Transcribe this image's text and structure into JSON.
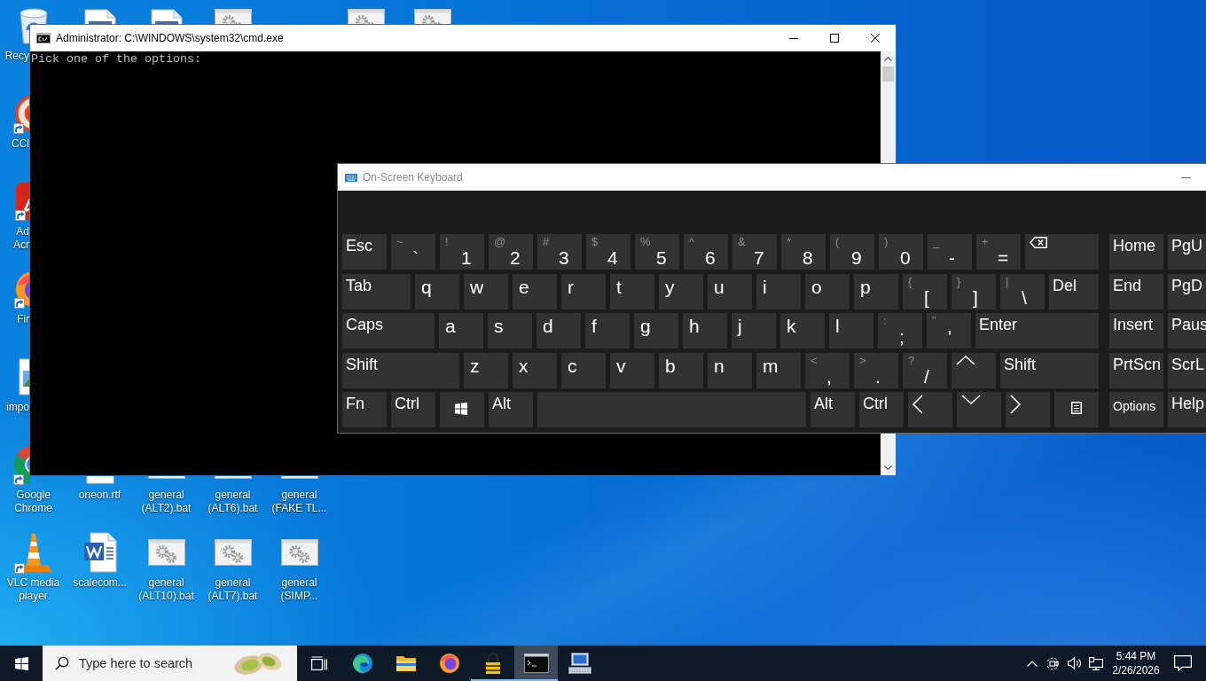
{
  "desktop": {
    "left_edge_icons": [
      {
        "kind": "bin",
        "label": "Recy",
        "shortcut": false
      },
      {
        "kind": "ccleaner",
        "label": "CCl",
        "shortcut": true
      },
      {
        "kind": "acrobat",
        "label": "Ad Acr",
        "shortcut": true
      },
      {
        "kind": "firefox",
        "label": "Fir",
        "shortcut": true
      },
      {
        "kind": "image",
        "label": "impo",
        "shortcut": false
      }
    ],
    "top_edge_icons": [
      {
        "kind": "document"
      },
      {
        "kind": "document"
      },
      {
        "kind": "batch"
      },
      {
        "kind": "batch"
      },
      {
        "kind": "batch"
      }
    ],
    "icon_rows": [
      [
        {
          "kind": "chrome",
          "label": "Google Chrome",
          "shortcut": true
        },
        {
          "kind": "rtf",
          "label": "oneon.rtf",
          "shortcut": false
        },
        {
          "kind": "batch",
          "label": "general (ALT2).bat",
          "shortcut": false
        },
        {
          "kind": "batch",
          "label": "general (ALT6).bat",
          "shortcut": false
        },
        {
          "kind": "batch",
          "label": "general (FAKE TL...",
          "shortcut": false
        }
      ],
      [
        {
          "kind": "vlc",
          "label": "VLC media player",
          "shortcut": true
        },
        {
          "kind": "word",
          "label": "scalecom...",
          "shortcut": false
        },
        {
          "kind": "batch",
          "label": "general (ALT10).bat",
          "shortcut": false
        },
        {
          "kind": "batch",
          "label": "general (ALT7).bat",
          "shortcut": false
        },
        {
          "kind": "batch",
          "label": "general (SIMP...",
          "shortcut": false
        }
      ]
    ]
  },
  "cmd_window": {
    "title": "Administrator: C:\\WINDOWS\\system32\\cmd.exe",
    "lines": [
      "Pick one of the options:"
    ]
  },
  "osk_window": {
    "title": "On-Screen Keyboard",
    "rows": [
      [
        {
          "kind": "word",
          "label": "Esc"
        },
        {
          "kind": "dual",
          "shift": "~",
          "label": "`"
        },
        {
          "kind": "dual",
          "shift": "!",
          "label": "1"
        },
        {
          "kind": "dual",
          "shift": "@",
          "label": "2"
        },
        {
          "kind": "dual",
          "shift": "#",
          "label": "3"
        },
        {
          "kind": "dual",
          "shift": "$",
          "label": "4"
        },
        {
          "kind": "dual",
          "shift": "%",
          "label": "5"
        },
        {
          "kind": "dual",
          "shift": "^",
          "label": "6"
        },
        {
          "kind": "dual",
          "shift": "&",
          "label": "7"
        },
        {
          "kind": "dual",
          "shift": "*",
          "label": "8"
        },
        {
          "kind": "dual",
          "shift": "(",
          "label": "9"
        },
        {
          "kind": "dual",
          "shift": ")",
          "label": "0"
        },
        {
          "kind": "dual",
          "shift": "_",
          "label": "-"
        },
        {
          "kind": "dual",
          "shift": "+",
          "label": "="
        },
        {
          "kind": "backspace"
        }
      ],
      [
        {
          "kind": "word",
          "label": "Tab"
        },
        {
          "kind": "letter",
          "label": "q"
        },
        {
          "kind": "letter",
          "label": "w"
        },
        {
          "kind": "letter",
          "label": "e"
        },
        {
          "kind": "letter",
          "label": "r"
        },
        {
          "kind": "letter",
          "label": "t"
        },
        {
          "kind": "letter",
          "label": "y"
        },
        {
          "kind": "letter",
          "label": "u"
        },
        {
          "kind": "letter",
          "label": "i"
        },
        {
          "kind": "letter",
          "label": "o"
        },
        {
          "kind": "letter",
          "label": "p"
        },
        {
          "kind": "dual",
          "shift": "{",
          "label": "["
        },
        {
          "kind": "dual",
          "shift": "}",
          "label": "]"
        },
        {
          "kind": "dual",
          "shift": "|",
          "label": "\\"
        },
        {
          "kind": "word",
          "label": "Del"
        }
      ],
      [
        {
          "kind": "word",
          "label": "Caps"
        },
        {
          "kind": "letter",
          "label": "a"
        },
        {
          "kind": "letter",
          "label": "s"
        },
        {
          "kind": "letter",
          "label": "d"
        },
        {
          "kind": "letter",
          "label": "f"
        },
        {
          "kind": "letter",
          "label": "g"
        },
        {
          "kind": "letter",
          "label": "h"
        },
        {
          "kind": "letter",
          "label": "j"
        },
        {
          "kind": "letter",
          "label": "k"
        },
        {
          "kind": "letter",
          "label": "l"
        },
        {
          "kind": "dual",
          "shift": ":",
          "label": ";"
        },
        {
          "kind": "dual",
          "shift": "\"",
          "label": "'"
        },
        {
          "kind": "word",
          "label": "Enter"
        }
      ],
      [
        {
          "kind": "word",
          "label": "Shift"
        },
        {
          "kind": "letter",
          "label": "z"
        },
        {
          "kind": "letter",
          "label": "x"
        },
        {
          "kind": "letter",
          "label": "c"
        },
        {
          "kind": "letter",
          "label": "v"
        },
        {
          "kind": "letter",
          "label": "b"
        },
        {
          "kind": "letter",
          "label": "n"
        },
        {
          "kind": "letter",
          "label": "m"
        },
        {
          "kind": "dual",
          "shift": "<",
          "label": ","
        },
        {
          "kind": "dual",
          "shift": ">",
          "label": "."
        },
        {
          "kind": "dual",
          "shift": "?",
          "label": "/"
        },
        {
          "kind": "up"
        },
        {
          "kind": "word",
          "label": "Shift"
        }
      ],
      [
        {
          "kind": "word",
          "label": "Fn"
        },
        {
          "kind": "word",
          "label": "Ctrl"
        },
        {
          "kind": "windows"
        },
        {
          "kind": "word",
          "label": "Alt"
        },
        {
          "kind": "space"
        },
        {
          "kind": "word",
          "label": "Alt"
        },
        {
          "kind": "word",
          "label": "Ctrl"
        },
        {
          "kind": "left"
        },
        {
          "kind": "down"
        },
        {
          "kind": "right"
        },
        {
          "kind": "menu"
        }
      ]
    ],
    "side_rows": [
      [
        {
          "kind": "word",
          "label": "Home"
        },
        {
          "kind": "word",
          "label": "PgU"
        }
      ],
      [
        {
          "kind": "word",
          "label": "End"
        },
        {
          "kind": "word",
          "label": "PgD"
        }
      ],
      [
        {
          "kind": "word",
          "label": "Insert"
        },
        {
          "kind": "word",
          "label": "Paus"
        }
      ],
      [
        {
          "kind": "word",
          "label": "PrtScn"
        },
        {
          "kind": "word",
          "label": "ScrL"
        }
      ],
      [
        {
          "kind": "small",
          "label": "Options"
        },
        {
          "kind": "word",
          "label": "Help"
        }
      ]
    ]
  },
  "taskbar": {
    "search": {
      "placeholder": "Type here to search"
    },
    "apps": [
      {
        "kind": "edge",
        "selected": false,
        "running": false
      },
      {
        "kind": "explorer",
        "selected": false,
        "running": false
      },
      {
        "kind": "firefox",
        "selected": false,
        "running": false
      },
      {
        "kind": "lock",
        "selected": false,
        "running": true
      },
      {
        "kind": "terminal",
        "selected": true,
        "running": true
      },
      {
        "kind": "keyboard",
        "selected": false,
        "running": false
      }
    ],
    "clock": {
      "time": "5:44 PM",
      "date": "2/26/2026"
    }
  }
}
